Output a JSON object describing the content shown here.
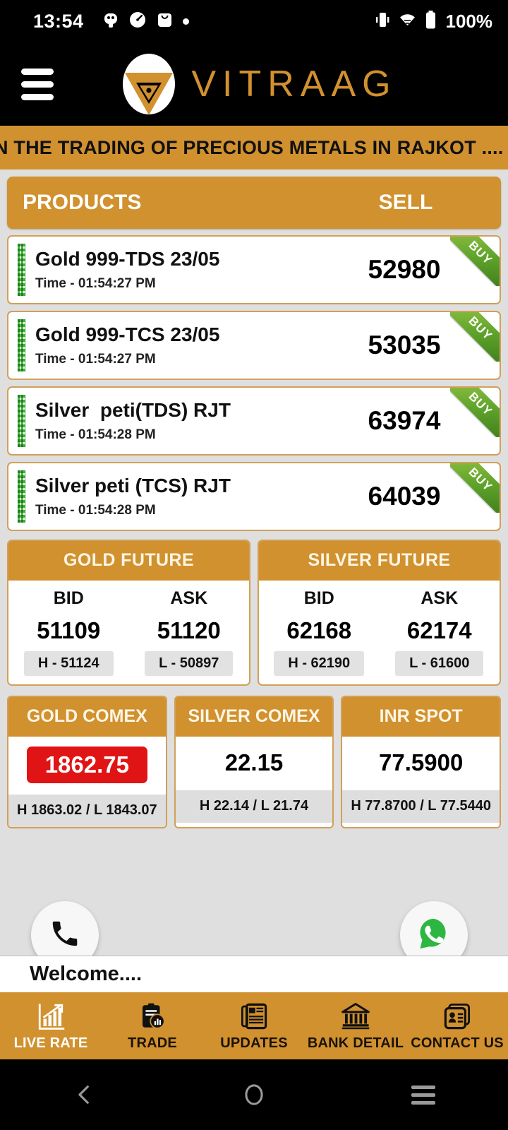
{
  "statusbar": {
    "time": "13:54",
    "battery": "100%",
    "icons": [
      "android-face-icon",
      "speedometer-icon",
      "shopping-bag-icon",
      "dot-icon"
    ],
    "right_icons": [
      "vibrate-icon",
      "wifi-icon",
      "battery-icon"
    ]
  },
  "appbar": {
    "menu_icon": "hamburger-menu-icon",
    "brand_name": "VITRAAG",
    "brand_color": "#d1912f"
  },
  "ticker": {
    "text": "N THE TRADING OF PRECIOUS METALS IN RAJKOT ...."
  },
  "products_header": {
    "products_label": "PRODUCTS",
    "sell_label": "SELL"
  },
  "rates": [
    {
      "name": "Gold 999-TDS 23/05",
      "time": "Time - 01:54:27 PM",
      "value": "52980",
      "ribbon": "BUY"
    },
    {
      "name": "Gold 999-TCS 23/05",
      "time": "Time - 01:54:27 PM",
      "value": "53035",
      "ribbon": "BUY"
    },
    {
      "name": "Silver  peti(TDS) RJT",
      "time": "Time - 01:54:28 PM",
      "value": "63974",
      "ribbon": "BUY"
    },
    {
      "name": "Silver peti (TCS) RJT",
      "time": "Time - 01:54:28 PM",
      "value": "64039",
      "ribbon": "BUY"
    }
  ],
  "futures": [
    {
      "title": "GOLD FUTURE",
      "bid_label": "BID",
      "ask_label": "ASK",
      "bid": "51109",
      "ask": "51120",
      "high": "H - 51124",
      "low": "L - 50897"
    },
    {
      "title": "SILVER FUTURE",
      "bid_label": "BID",
      "ask_label": "ASK",
      "bid": "62168",
      "ask": "62174",
      "high": "H - 62190",
      "low": "L - 61600"
    }
  ],
  "comex": [
    {
      "title": "GOLD COMEX",
      "value": "1862.75",
      "highlow": "H 1863.02 / L 1843.07",
      "state": "down"
    },
    {
      "title": "SILVER COMEX",
      "value": "22.15",
      "highlow": "H 22.14 / L 21.74",
      "state": "neutral"
    },
    {
      "title": "INR SPOT",
      "value": "77.5900",
      "highlow": "H 77.8700 / L 77.5440",
      "state": "neutral"
    }
  ],
  "fabs": {
    "call": "phone-call-icon",
    "whatsapp": "whatsapp-icon"
  },
  "welcome": {
    "text": "Welcome...."
  },
  "bottomnav": {
    "items": [
      {
        "label": "LIVE RATE",
        "icon": "growth-chart-icon",
        "active": true
      },
      {
        "label": "TRADE",
        "icon": "clipboard-chart-icon",
        "active": false
      },
      {
        "label": "UPDATES",
        "icon": "newspaper-icon",
        "active": false
      },
      {
        "label": "BANK DETAIL",
        "icon": "bank-building-icon",
        "active": false
      },
      {
        "label": "CONTACT US",
        "icon": "contact-card-icon",
        "active": false
      }
    ]
  },
  "sysnav": {
    "back": "back-chevron-icon",
    "home": "home-circle-icon",
    "recents": "recents-lines-icon"
  }
}
